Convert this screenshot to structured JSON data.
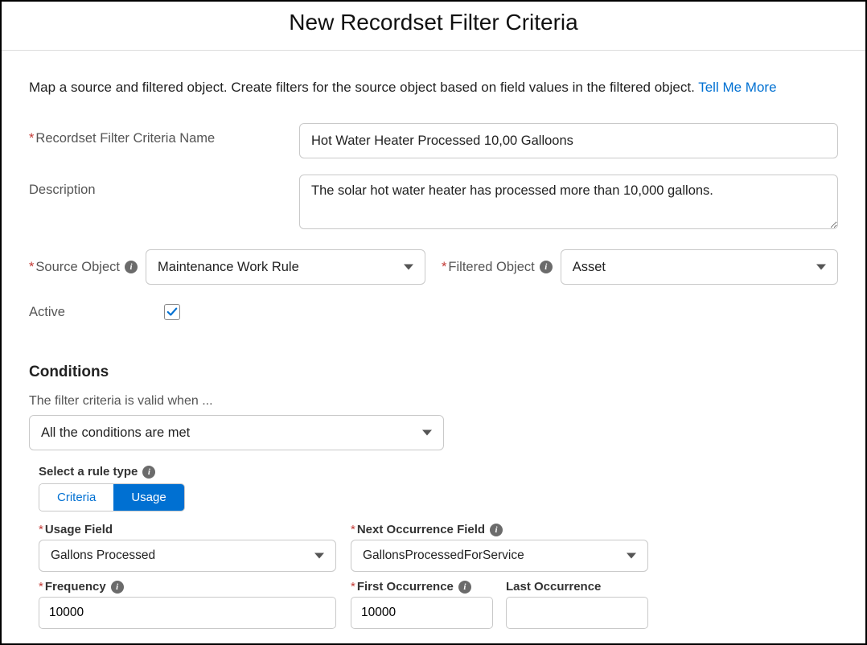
{
  "header": {
    "title": "New Recordset Filter Criteria"
  },
  "intro": {
    "text": "Map a source and filtered object. Create filters for the source object based on field values in the filtered object. ",
    "link": "Tell Me More"
  },
  "form": {
    "name_label": "Recordset Filter Criteria Name",
    "name_value": "Hot Water Heater Processed 10,00 Galloons",
    "desc_label": "Description",
    "desc_value": "The solar hot water heater has processed more than 10,000 gallons.",
    "source_label": "Source Object",
    "source_value": "Maintenance Work Rule",
    "filtered_label": "Filtered Object",
    "filtered_value": "Asset",
    "active_label": "Active"
  },
  "conditions": {
    "title": "Conditions",
    "hint": "The filter criteria is valid when ...",
    "match_value": "All the conditions are met",
    "rule_type_label": "Select a rule type",
    "tabs": {
      "criteria": "Criteria",
      "usage": "Usage"
    },
    "usage_field_label": "Usage Field",
    "usage_field_value": "Gallons Processed",
    "next_occ_label": "Next Occurrence Field",
    "next_occ_value": "GallonsProcessedForService",
    "frequency_label": "Frequency",
    "frequency_value": "10000",
    "first_occ_label": "First Occurrence",
    "first_occ_value": "10000",
    "last_occ_label": "Last Occurrence",
    "last_occ_value": ""
  }
}
